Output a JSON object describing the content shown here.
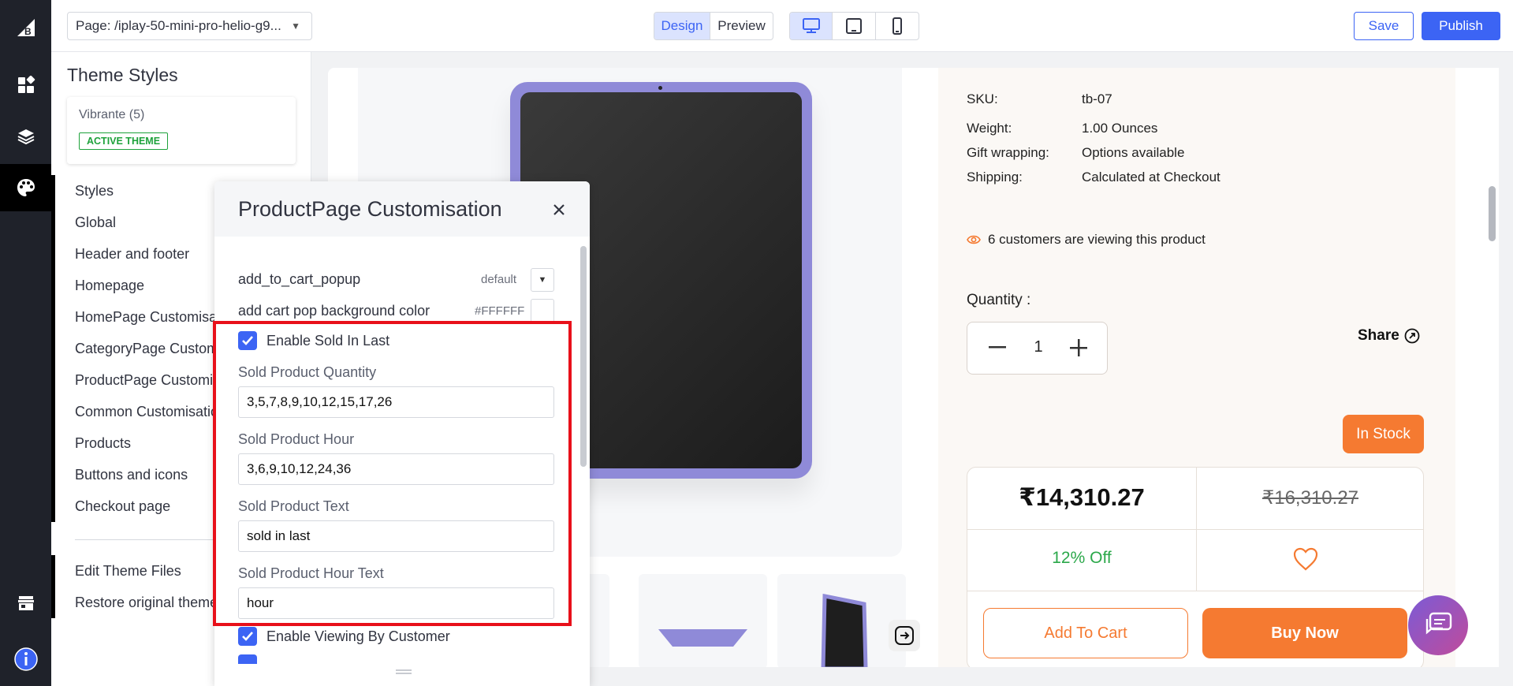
{
  "topbar": {
    "page_select": "Page: /iplay-50-mini-pro-helio-g9...",
    "view_tabs": [
      "Design",
      "Preview"
    ],
    "save_label": "Save",
    "publish_label": "Publish"
  },
  "sidebar": {
    "title": "Theme Styles",
    "theme_name": "Vibrante (5)",
    "theme_badge": "ACTIVE THEME",
    "items": [
      "Styles",
      "Global",
      "Header and footer",
      "Homepage",
      "HomePage Customisation",
      "CategoryPage Customisation",
      "ProductPage Customisation",
      "Common Customisation",
      "Products",
      "Buttons and icons",
      "Checkout page"
    ],
    "footer_items": [
      "Edit Theme Files",
      "Restore original theme"
    ]
  },
  "modal": {
    "title": "ProductPage Customisation",
    "rows": [
      {
        "label": "add_to_cart_popup",
        "value": "default"
      },
      {
        "label": "add cart pop background color",
        "value": "#FFFFFF"
      }
    ],
    "enable_sold_label": "Enable Sold In Last",
    "fields": [
      {
        "label": "Sold Product Quantity",
        "value": "3,5,7,8,9,10,12,15,17,26"
      },
      {
        "label": "Sold Product Hour",
        "value": "3,6,9,10,12,24,36"
      },
      {
        "label": "Sold Product Text",
        "value": "sold in last"
      },
      {
        "label": "Sold Product Hour Text",
        "value": "hour"
      }
    ],
    "enable_viewing_label": "Enable Viewing By Customer"
  },
  "product": {
    "specs": [
      {
        "key": "SKU:",
        "value": "tb-07"
      },
      {
        "key": "Weight:",
        "value": "1.00 Ounces"
      },
      {
        "key": "Gift wrapping:",
        "value": "Options available"
      },
      {
        "key": "Shipping:",
        "value": "Calculated at Checkout"
      }
    ],
    "viewing_text": "6 customers are viewing this product",
    "quantity_label": "Quantity :",
    "quantity_value": "1",
    "share_label": "Share",
    "stock_label": "In Stock",
    "price": "₹14,310.27",
    "old_price": "₹16,310.27",
    "discount": "12% Off",
    "add_to_cart_label": "Add To Cart",
    "buy_now_label": "Buy Now"
  },
  "colors": {
    "accent": "#3c64f4",
    "brand_orange": "#f57a31",
    "highlight_red": "#e8101a",
    "success_green": "#2ba84a"
  }
}
